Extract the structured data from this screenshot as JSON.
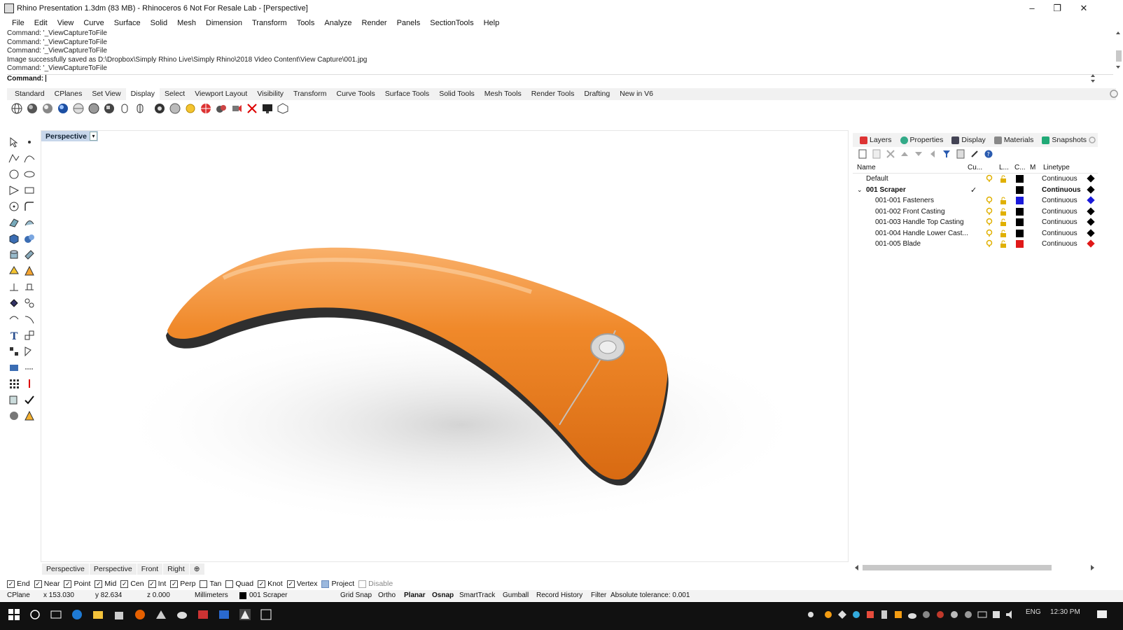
{
  "window": {
    "title": "Rhino Presentation 1.3dm (83 MB) - Rhinoceros 6 Not For Resale Lab - [Perspective]",
    "minimize": "–",
    "restore": "❐",
    "close": "✕"
  },
  "menu": [
    "File",
    "Edit",
    "View",
    "Curve",
    "Surface",
    "Solid",
    "Mesh",
    "Dimension",
    "Transform",
    "Tools",
    "Analyze",
    "Render",
    "Panels",
    "SectionTools",
    "Help"
  ],
  "command": {
    "history": [
      "Command: '_ViewCaptureToFile",
      "Command: '_ViewCaptureToFile",
      "Command: '_ViewCaptureToFile",
      "Image successfully saved as D:\\Dropbox\\Simply Rhino Live\\Simply Rhino\\2018 Video Content\\View Capture\\001.jpg",
      "Command: '_ViewCaptureToFile"
    ],
    "prompt": "Command:"
  },
  "toolbar_tabs": [
    "Standard",
    "CPlanes",
    "Set View",
    "Display",
    "Select",
    "Viewport Layout",
    "Visibility",
    "Transform",
    "Curve Tools",
    "Surface Tools",
    "Solid Tools",
    "Mesh Tools",
    "Render Tools",
    "Drafting",
    "New in V6"
  ],
  "active_toolbar_tab": "Display",
  "viewport": {
    "title": "Perspective",
    "dropdown": "▾"
  },
  "viewport_tabs": [
    "Perspective",
    "Perspective",
    "Front",
    "Right",
    "⊕"
  ],
  "panel": {
    "tabs": [
      "Layers",
      "Properties",
      "Display",
      "Materials",
      "Snapshots"
    ],
    "headers": {
      "name": "Name",
      "current": "Cu...",
      "lock": "L...",
      "color": "C...",
      "material": "M",
      "linetype": "Linetype"
    },
    "layers": [
      {
        "name": "Default",
        "current": "",
        "linetype": "Continuous",
        "color": "#000000",
        "print": "#000000",
        "bold": false,
        "indent": 0
      },
      {
        "name": "001 Scraper",
        "current": "✓",
        "linetype": "Continuous",
        "color": "#000000",
        "print": "#000000",
        "bold": true,
        "indent": 0,
        "expand": "⌄"
      },
      {
        "name": "001-001 Fasteners",
        "current": "",
        "linetype": "Continuous",
        "color": "#1a1adb",
        "print": "#1a1adb",
        "bold": false,
        "indent": 1
      },
      {
        "name": "001-002 Front Casting",
        "current": "",
        "linetype": "Continuous",
        "color": "#000000",
        "print": "#000000",
        "bold": false,
        "indent": 1
      },
      {
        "name": "001-003 Handle Top Casting",
        "current": "",
        "linetype": "Continuous",
        "color": "#000000",
        "print": "#000000",
        "bold": false,
        "indent": 1
      },
      {
        "name": "001-004 Handle Lower Cast...",
        "current": "",
        "linetype": "Continuous",
        "color": "#000000",
        "print": "#000000",
        "bold": false,
        "indent": 1
      },
      {
        "name": "001-005 Blade",
        "current": "",
        "linetype": "Continuous",
        "color": "#e01919",
        "print": "#e01919",
        "bold": false,
        "indent": 1
      }
    ]
  },
  "osnaps": [
    {
      "label": "End",
      "checked": true
    },
    {
      "label": "Near",
      "checked": true
    },
    {
      "label": "Point",
      "checked": true
    },
    {
      "label": "Mid",
      "checked": true
    },
    {
      "label": "Cen",
      "checked": true
    },
    {
      "label": "Int",
      "checked": true
    },
    {
      "label": "Perp",
      "checked": true
    },
    {
      "label": "Tan",
      "checked": false
    },
    {
      "label": "Quad",
      "checked": false
    },
    {
      "label": "Knot",
      "checked": true
    },
    {
      "label": "Vertex",
      "checked": true
    },
    {
      "label": "Project",
      "checked": false
    },
    {
      "label": "Disable",
      "checked": false
    }
  ],
  "status": {
    "cplane": "CPlane",
    "x": "x 153.030",
    "y": "y 82.634",
    "z": "z 0.000",
    "units": "Millimeters",
    "layer": "001 Scraper",
    "grid_snap": "Grid Snap",
    "ortho": "Ortho",
    "planar": "Planar",
    "osnap": "Osnap",
    "smarttrack": "SmartTrack",
    "gumball": "Gumball",
    "record_history": "Record History",
    "filter": "Filter",
    "tolerance": "Absolute tolerance: 0.001"
  },
  "taskbar": {
    "lang": "ENG",
    "time": "12:30 PM"
  },
  "colors": {
    "accent": "#c7d6ea",
    "model_orange": "#f08a2c",
    "model_dark": "#333333"
  }
}
